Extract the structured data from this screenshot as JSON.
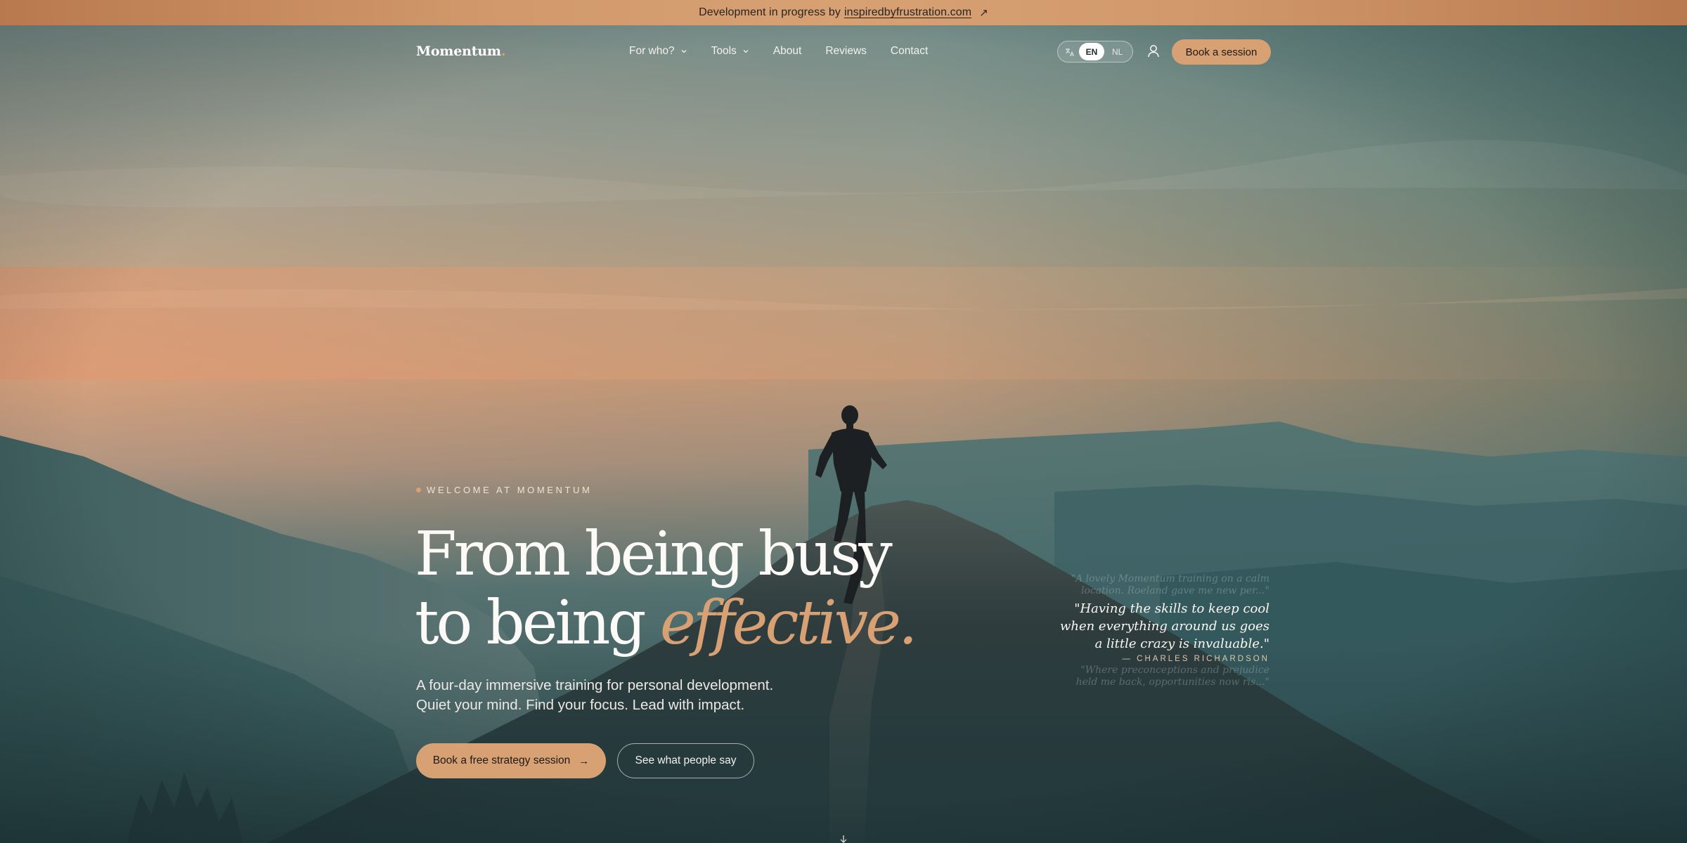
{
  "banner": {
    "text": "Development in progress by",
    "link": "inspiredbyfrustration.com",
    "arrow_icon": "arrow-up-right-icon"
  },
  "nav": {
    "logo": "Momentum",
    "logo_dot": ".",
    "items": [
      {
        "label": "For who?",
        "dropdown": true
      },
      {
        "label": "Tools",
        "dropdown": true
      },
      {
        "label": "About"
      },
      {
        "label": "Reviews"
      },
      {
        "label": "Contact"
      }
    ],
    "language": {
      "icon": "translate-icon",
      "active": "EN",
      "other": "NL"
    },
    "user_icon": "user-icon",
    "cta": "Book a session"
  },
  "hero": {
    "eyebrow": "WELCOME AT MOMENTUM",
    "headline_line1": "From being busy",
    "headline_line2_prefix": "to being ",
    "headline_accent": "effective.",
    "subtitle_line1": "A four-day immersive training for personal development.",
    "subtitle_line2": "Quiet your mind. Find your focus. Lead with impact.",
    "primary_cta": "Book a free strategy session",
    "primary_cta_arrow": "→",
    "secondary_cta": "See what people say"
  },
  "testimonials": {
    "prev": "\"A lovely Momentum training on a calm location. Roeland gave me new per...\"",
    "current_quote": "\"Having the skills to keep cool when everything around us goes a little crazy is invaluable.\"",
    "current_author": "— CHARLES RICHARDSON",
    "next": "\"Where preconceptions and prejudice held me back, opportunities now ris...\""
  },
  "colors": {
    "accent": "#d7a173",
    "banner": "#d29a6c",
    "text_dark": "#1f1a16"
  }
}
